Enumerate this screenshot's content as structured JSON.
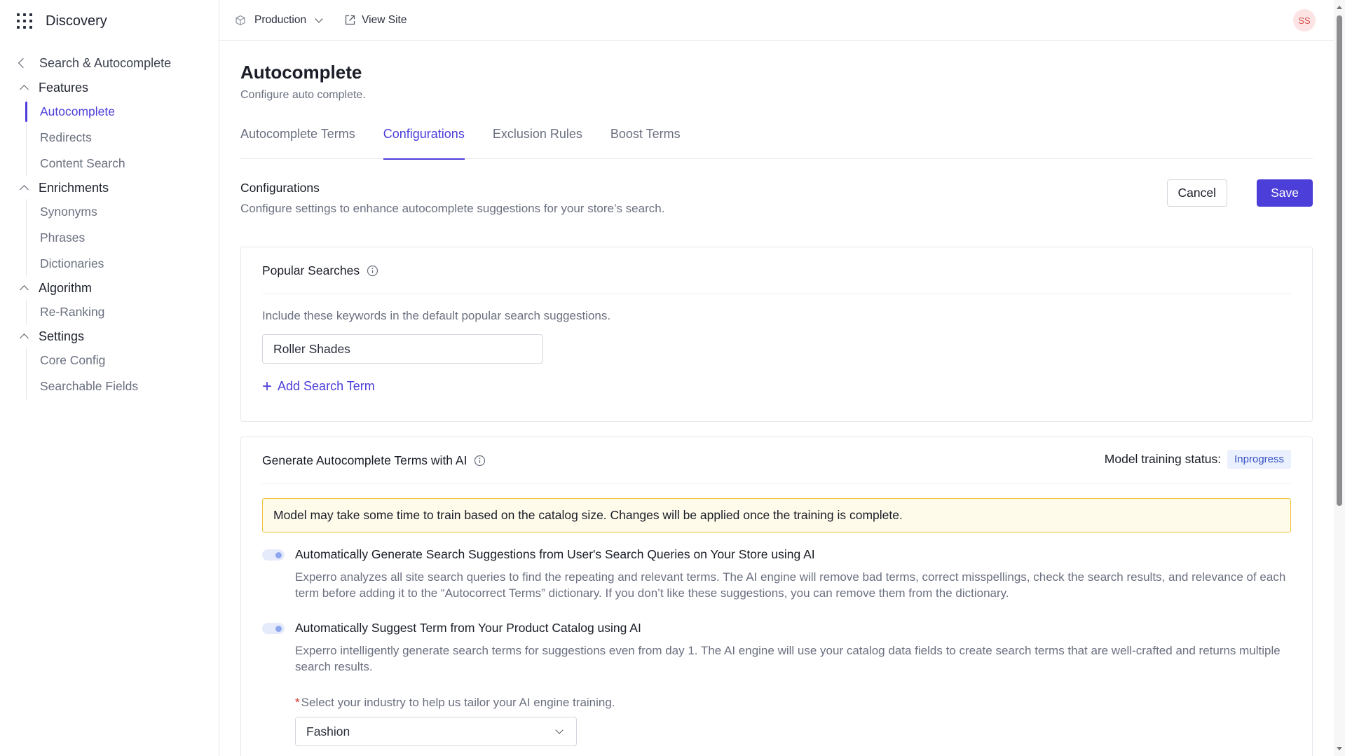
{
  "app": {
    "name": "Discovery"
  },
  "sidebar": {
    "back_label": "Search & Autocomplete",
    "sections": [
      {
        "label": "Features",
        "items": [
          {
            "label": "Autocomplete",
            "active": true
          },
          {
            "label": "Redirects"
          },
          {
            "label": "Content Search"
          }
        ]
      },
      {
        "label": "Enrichments",
        "items": [
          {
            "label": "Synonyms"
          },
          {
            "label": "Phrases"
          },
          {
            "label": "Dictionaries"
          }
        ]
      },
      {
        "label": "Algorithm",
        "items": [
          {
            "label": "Re-Ranking"
          }
        ]
      },
      {
        "label": "Settings",
        "items": [
          {
            "label": "Core Config"
          },
          {
            "label": "Searchable Fields"
          }
        ]
      }
    ]
  },
  "topbar": {
    "environment": "Production",
    "view_site": "View Site",
    "avatar_initials": "SS"
  },
  "page": {
    "title": "Autocomplete",
    "subtitle": "Configure auto complete.",
    "tabs": [
      {
        "label": "Autocomplete Terms"
      },
      {
        "label": "Configurations",
        "active": true
      },
      {
        "label": "Exclusion Rules"
      },
      {
        "label": "Boost Terms"
      }
    ]
  },
  "configurations": {
    "title": "Configurations",
    "description": "Configure settings to enhance autocomplete suggestions for your store’s search.",
    "cancel_label": "Cancel",
    "save_label": "Save"
  },
  "popular_searches": {
    "title": "Popular Searches",
    "description": "Include these keywords in the default popular search suggestions.",
    "term_value": "Roller Shades",
    "add_label": "Add Search Term"
  },
  "ai_generate": {
    "title": "Generate Autocomplete Terms with AI",
    "status_label": "Model training status:",
    "status_value": "Inprogress",
    "warning": "Model may take some time to train based on the catalog size. Changes will be applied once the training is complete.",
    "option1": {
      "title": "Automatically Generate Search Suggestions from User's Search Queries on Your Store using AI",
      "description": "Experro analyzes all site search queries to find the repeating and relevant terms. The AI engine will remove bad terms, correct misspellings, check the search results, and relevance of each term before adding it to the “Autocorrect Terms” dictionary. If you don’t like these suggestions, you can remove them from the dictionary."
    },
    "option2": {
      "title": "Automatically Suggest Term from Your Product Catalog using AI",
      "description": "Experro intelligently generate search terms for suggestions even from day 1. The AI engine will use your catalog data fields to create search terms that are well-crafted and returns multiple search results."
    },
    "industry_label": "Select your industry to help us tailor your AI engine training.",
    "industry_required_mark": "*",
    "industry_value": "Fashion"
  },
  "colors": {
    "accent": "#4c3ed9",
    "warning_border": "#efc23a",
    "warning_bg": "#fffbeb",
    "badge_bg": "#eaf0fd",
    "badge_text": "#3552c4"
  }
}
